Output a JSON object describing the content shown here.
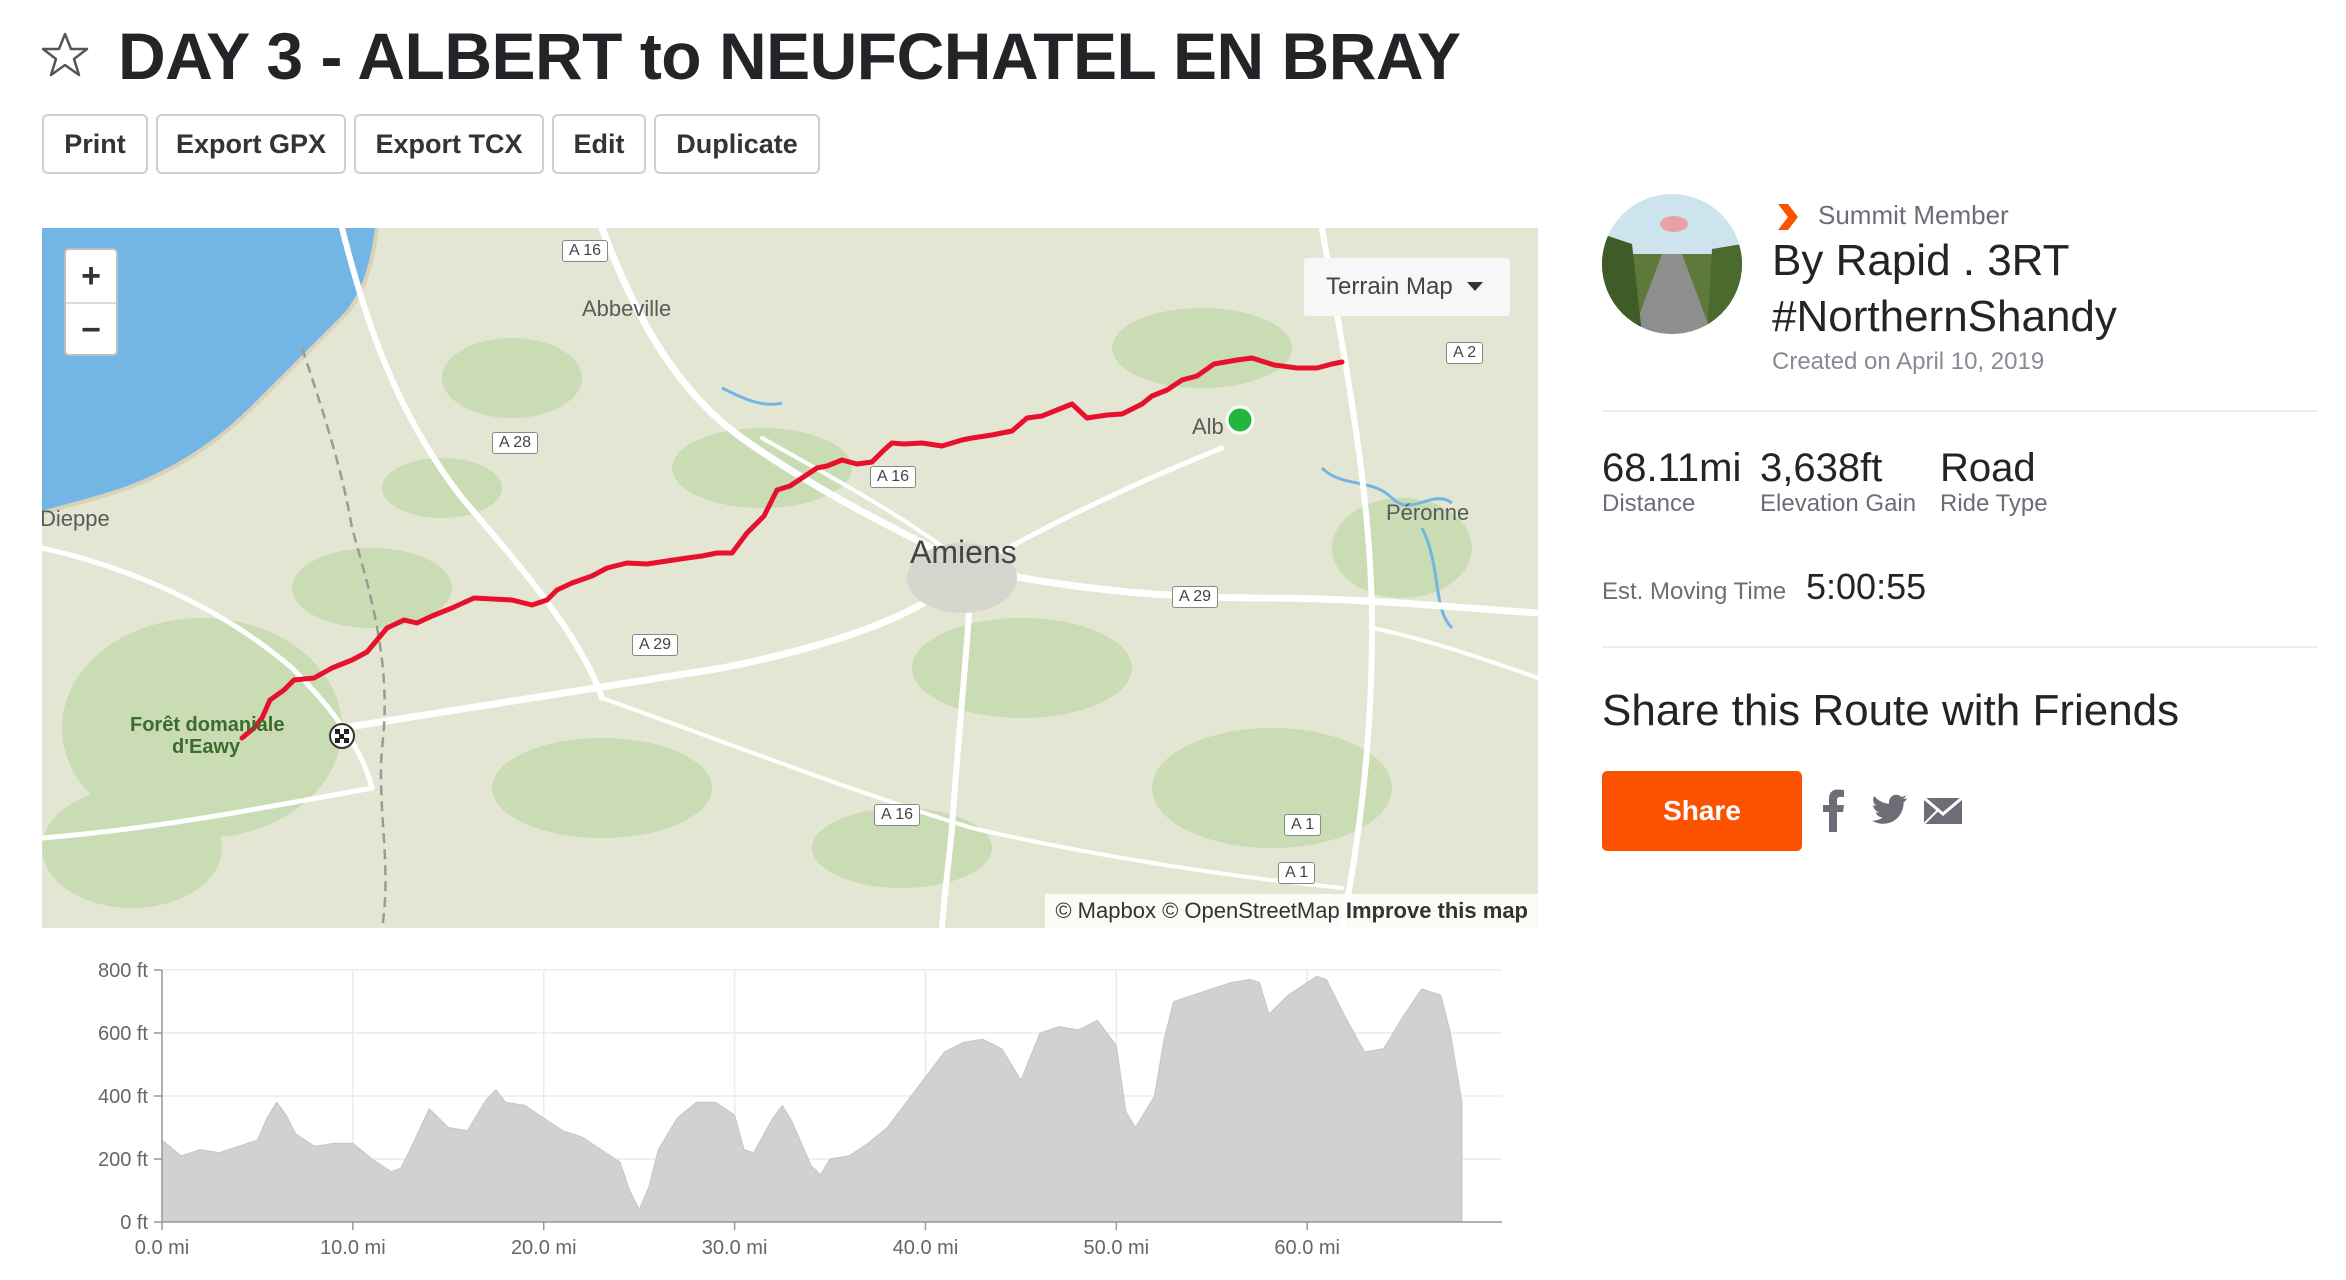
{
  "header": {
    "title": "DAY 3 - ALBERT to NEUFCHATEL EN BRAY",
    "star_icon": "star-outline-icon"
  },
  "toolbar": {
    "buttons": [
      {
        "label": "Print"
      },
      {
        "label": "Export GPX"
      },
      {
        "label": "Export TCX"
      },
      {
        "label": "Edit"
      },
      {
        "label": "Duplicate"
      }
    ]
  },
  "map": {
    "zoom_in": "+",
    "zoom_out": "−",
    "style_select": "Terrain Map",
    "attribution": {
      "mapbox": "© Mapbox",
      "osm": "© OpenStreetMap",
      "improve": "Improve this map"
    },
    "places": [
      "Abbeville",
      "Dieppe",
      "Amiens",
      "Péronne",
      "Forêt domaniale",
      "d'Eawy",
      "Alb"
    ],
    "roads": [
      "A 16",
      "A 16",
      "A 16",
      "A 28",
      "A 29",
      "A 29",
      "A 2",
      "A 1",
      "A 1"
    ],
    "colors": {
      "route": "#e8112d",
      "start": "#22b73c",
      "water": "#73b6e6",
      "land": "#e3e6d2",
      "forest": "#c5dbb0"
    }
  },
  "elevation": {
    "y_ticks": [
      "800 ft",
      "600 ft",
      "400 ft",
      "200 ft",
      "0 ft"
    ],
    "x_ticks": [
      "0.0 mi",
      "10.0 mi",
      "20.0 mi",
      "30.0 mi",
      "40.0 mi",
      "50.0 mi",
      "60.0 mi"
    ],
    "profile_ft": [
      [
        0,
        260
      ],
      [
        1,
        210
      ],
      [
        2,
        230
      ],
      [
        3,
        220
      ],
      [
        4,
        240
      ],
      [
        5,
        260
      ],
      [
        5.5,
        330
      ],
      [
        6,
        380
      ],
      [
        6.5,
        340
      ],
      [
        7,
        280
      ],
      [
        8,
        240
      ],
      [
        9,
        250
      ],
      [
        10,
        250
      ],
      [
        11,
        200
      ],
      [
        12,
        160
      ],
      [
        12.5,
        170
      ],
      [
        13,
        230
      ],
      [
        14,
        360
      ],
      [
        15,
        300
      ],
      [
        16,
        290
      ],
      [
        17,
        390
      ],
      [
        17.5,
        420
      ],
      [
        18,
        380
      ],
      [
        19,
        370
      ],
      [
        20,
        330
      ],
      [
        21,
        290
      ],
      [
        22,
        270
      ],
      [
        23,
        230
      ],
      [
        24,
        190
      ],
      [
        24.5,
        100
      ],
      [
        25,
        40
      ],
      [
        25.5,
        110
      ],
      [
        26,
        230
      ],
      [
        27,
        330
      ],
      [
        28,
        380
      ],
      [
        29,
        380
      ],
      [
        30,
        340
      ],
      [
        30.5,
        230
      ],
      [
        31,
        220
      ],
      [
        32,
        330
      ],
      [
        32.5,
        370
      ],
      [
        33,
        320
      ],
      [
        34,
        180
      ],
      [
        34.5,
        150
      ],
      [
        35,
        200
      ],
      [
        36,
        210
      ],
      [
        37,
        250
      ],
      [
        38,
        300
      ],
      [
        39,
        380
      ],
      [
        40,
        460
      ],
      [
        41,
        540
      ],
      [
        42,
        570
      ],
      [
        43,
        580
      ],
      [
        44,
        550
      ],
      [
        44.5,
        500
      ],
      [
        45,
        450
      ],
      [
        46,
        600
      ],
      [
        47,
        620
      ],
      [
        48,
        610
      ],
      [
        49,
        640
      ],
      [
        50,
        560
      ],
      [
        50.5,
        350
      ],
      [
        51,
        300
      ],
      [
        52,
        400
      ],
      [
        52.5,
        580
      ],
      [
        53,
        700
      ],
      [
        54,
        720
      ],
      [
        55,
        740
      ],
      [
        56,
        760
      ],
      [
        57,
        770
      ],
      [
        57.5,
        760
      ],
      [
        58,
        660
      ],
      [
        59,
        720
      ],
      [
        60,
        760
      ],
      [
        60.5,
        780
      ],
      [
        61,
        770
      ],
      [
        62,
        650
      ],
      [
        63,
        540
      ],
      [
        64,
        550
      ],
      [
        65,
        650
      ],
      [
        66,
        740
      ],
      [
        67,
        720
      ],
      [
        67.5,
        600
      ],
      [
        68.11,
        380
      ]
    ]
  },
  "author": {
    "badge": "Summit Member",
    "name_line1": "By Rapid . 3RT",
    "name_line2": "#NorthernShandy",
    "created": "Created on April 10, 2019"
  },
  "stats": {
    "distance": {
      "value": "68.11mi",
      "label": "Distance"
    },
    "elevation": {
      "value": "3,638ft",
      "label": "Elevation Gain"
    },
    "ride_type": {
      "value": "Road",
      "label": "Ride Type"
    },
    "moving_time": {
      "label": "Est. Moving Time",
      "value": "5:00:55"
    }
  },
  "share": {
    "title": "Share this Route with Friends",
    "button": "Share",
    "icons": [
      "facebook-icon",
      "twitter-icon",
      "email-icon"
    ],
    "accent": "#fc5200"
  }
}
